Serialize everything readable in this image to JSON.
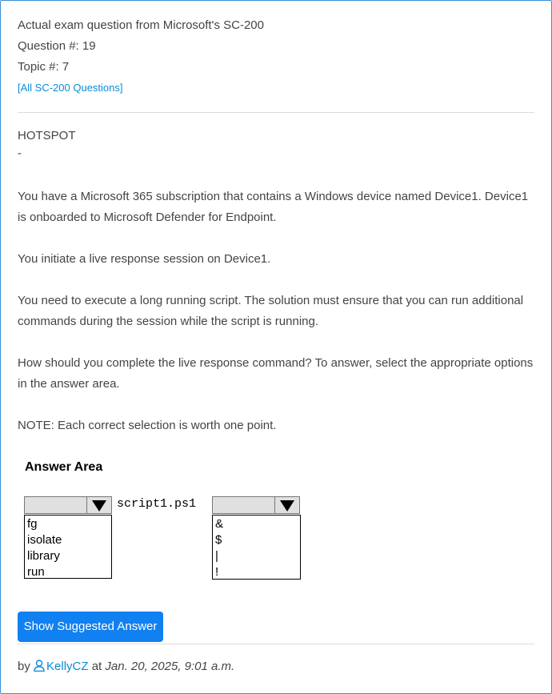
{
  "header": {
    "exam_line": "Actual exam question from Microsoft's SC-200",
    "question_line": "Question #: 19",
    "topic_line": "Topic #: 7",
    "all_questions_link": "[All SC-200 Questions]"
  },
  "question": {
    "type": "HOTSPOT",
    "dash": "-",
    "paragraphs": [
      "You have a Microsoft 365 subscription that contains a Windows device named Device1. Device1 is onboarded to Microsoft Defender for Endpoint.",
      "You initiate a live response session on Device1.",
      "You need to execute a long running script. The solution must ensure that you can run additional commands during the session while the script is running.",
      "How should you complete the live response command? To answer, select the appropriate options in the answer area.",
      "NOTE: Each correct selection is worth one point."
    ]
  },
  "answer_area": {
    "title": "Answer Area",
    "script_text": "script1.ps1",
    "dropdown1": {
      "selected": "",
      "options": [
        "fg",
        "isolate",
        "library",
        "run"
      ]
    },
    "dropdown2": {
      "selected": "",
      "options": [
        "&",
        "$",
        "|",
        "!"
      ]
    }
  },
  "actions": {
    "show_answer_label": "Show Suggested Answer"
  },
  "byline": {
    "prefix": "by",
    "user": "KellyCZ",
    "at": "at",
    "date": "Jan. 20, 2025, 9:01 a.m."
  },
  "colors": {
    "link": "#0b8bd6",
    "button": "#1180f0",
    "frame_border": "#3a8fd6"
  }
}
